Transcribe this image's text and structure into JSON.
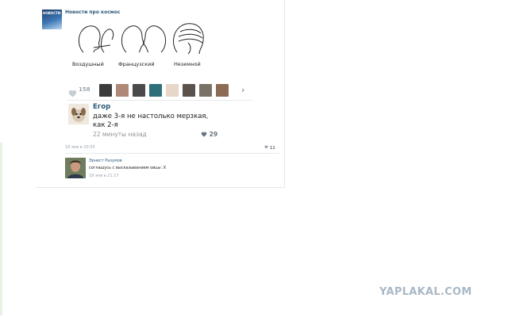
{
  "post": {
    "group_name": "Новости про космос",
    "avatar_text": "НОВОСТИ",
    "image_captions": [
      "Воздушный",
      "Французский",
      "Неземной"
    ],
    "likes_count": "158",
    "date": "18 янв в 20:55",
    "total_likes": "11"
  },
  "comment": {
    "author": "Егор",
    "text": "даже 3-я не настолько мерзкая, как 2-я",
    "time": "22 минуты назад",
    "likes": "29"
  },
  "reply": {
    "author": "Эрнест Разумов",
    "text": "соглашусь с высказыванием овцы :X",
    "time": "18 янв в 21:17"
  },
  "watermark": "YAPLAKAL.COM",
  "colors": {
    "link": "#2b587a",
    "muted": "#9aa4ad",
    "watermark": "#a9b8c6"
  }
}
